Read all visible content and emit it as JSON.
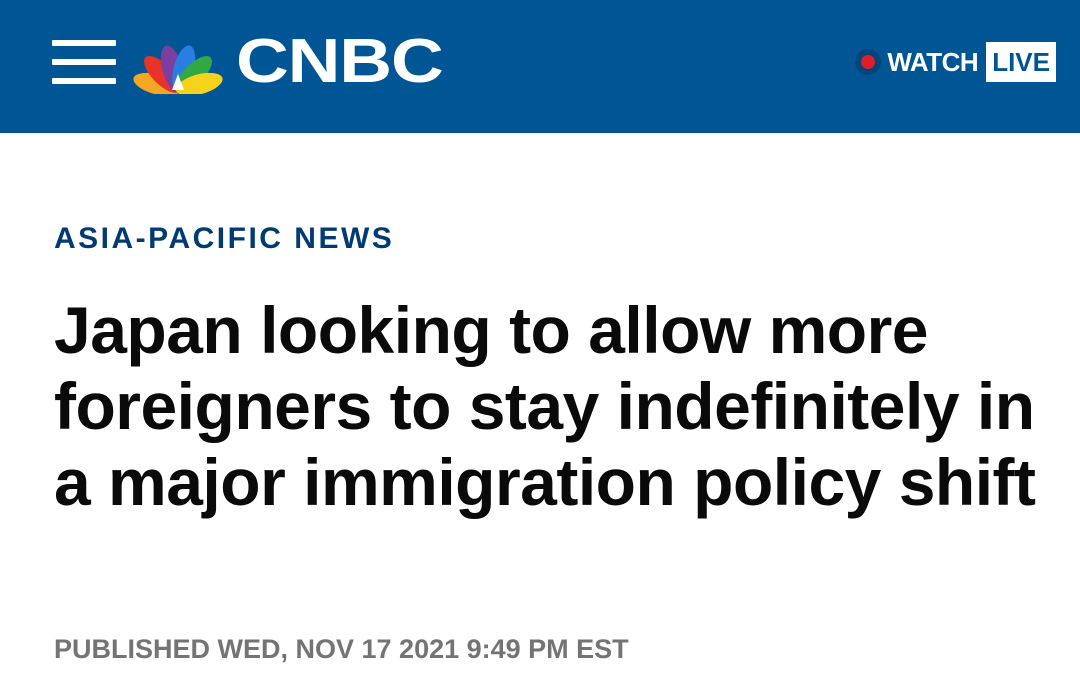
{
  "header": {
    "brand": "CNBC",
    "watch_label": "WATCH",
    "live_label": "LIVE",
    "colors": {
      "bar": "#005594",
      "live_dot": "#e11d2a"
    }
  },
  "article": {
    "kicker": "ASIA-PACIFIC NEWS",
    "headline": "Japan looking to allow more foreigners to stay indefinitely in a major immigration policy shift",
    "published": "PUBLISHED WED, NOV 17 2021 9:49 PM EST"
  }
}
